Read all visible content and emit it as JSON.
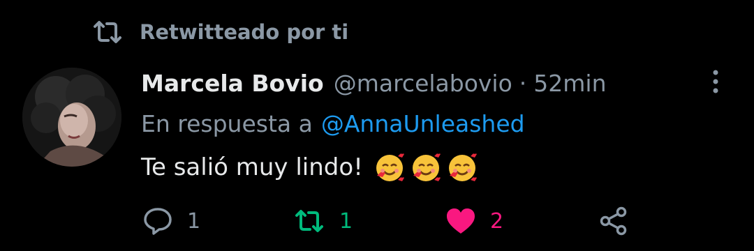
{
  "retweet_context": {
    "label": "Retwitteado por ti",
    "icon": "retweet-icon"
  },
  "tweet": {
    "author": {
      "display_name": "Marcela Bovio",
      "handle": "@marcelabovio",
      "avatar": "avatar-photo"
    },
    "separator": "·",
    "time": "52min",
    "reply_to": {
      "prefix": "En respuesta a",
      "mention": "@AnnaUnleashed"
    },
    "text": "Te salió muy lindo!",
    "emojis": [
      "smiling-face-with-hearts",
      "smiling-face-with-hearts",
      "smiling-face-with-hearts"
    ],
    "more_icon": "more-vertical-icon"
  },
  "actions": {
    "reply": {
      "count": "1",
      "icon": "reply-icon"
    },
    "retweet": {
      "count": "1",
      "icon": "retweet-icon",
      "active": true
    },
    "like": {
      "count": "2",
      "icon": "heart-icon",
      "active": true
    },
    "share": {
      "icon": "share-icon"
    }
  },
  "colors": {
    "background": "#000000",
    "primary_text": "#e7e9ea",
    "secondary_text": "#8b98a5",
    "link": "#1d9bf0",
    "retweet_active": "#00ba7c",
    "like_active": "#f91880"
  }
}
